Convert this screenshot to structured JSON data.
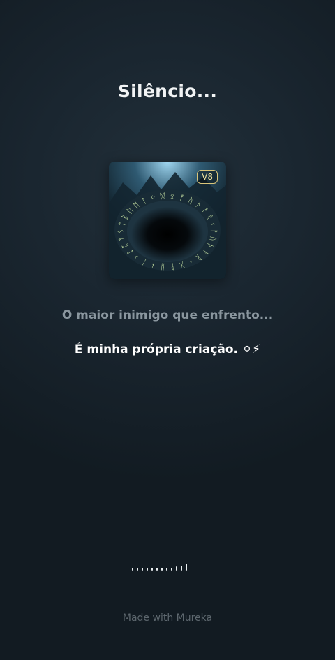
{
  "song": {
    "title": "Silêncio...",
    "version_badge": "V8"
  },
  "lyrics": {
    "previous_line": "O maior inimigo que enfrento...",
    "current_line": "É minha própria criação. ⚪⚡"
  },
  "footer": {
    "credit": "Made with Mureka"
  },
  "waveform_levels": [
    0.25,
    0.25,
    0.25,
    0.25,
    0.25,
    0.25,
    0.25,
    0.25,
    0.25,
    0.35,
    0.45,
    0.6
  ],
  "colors": {
    "rune_glow": "#cde8a8",
    "badge_gold": "#d9c57a"
  }
}
